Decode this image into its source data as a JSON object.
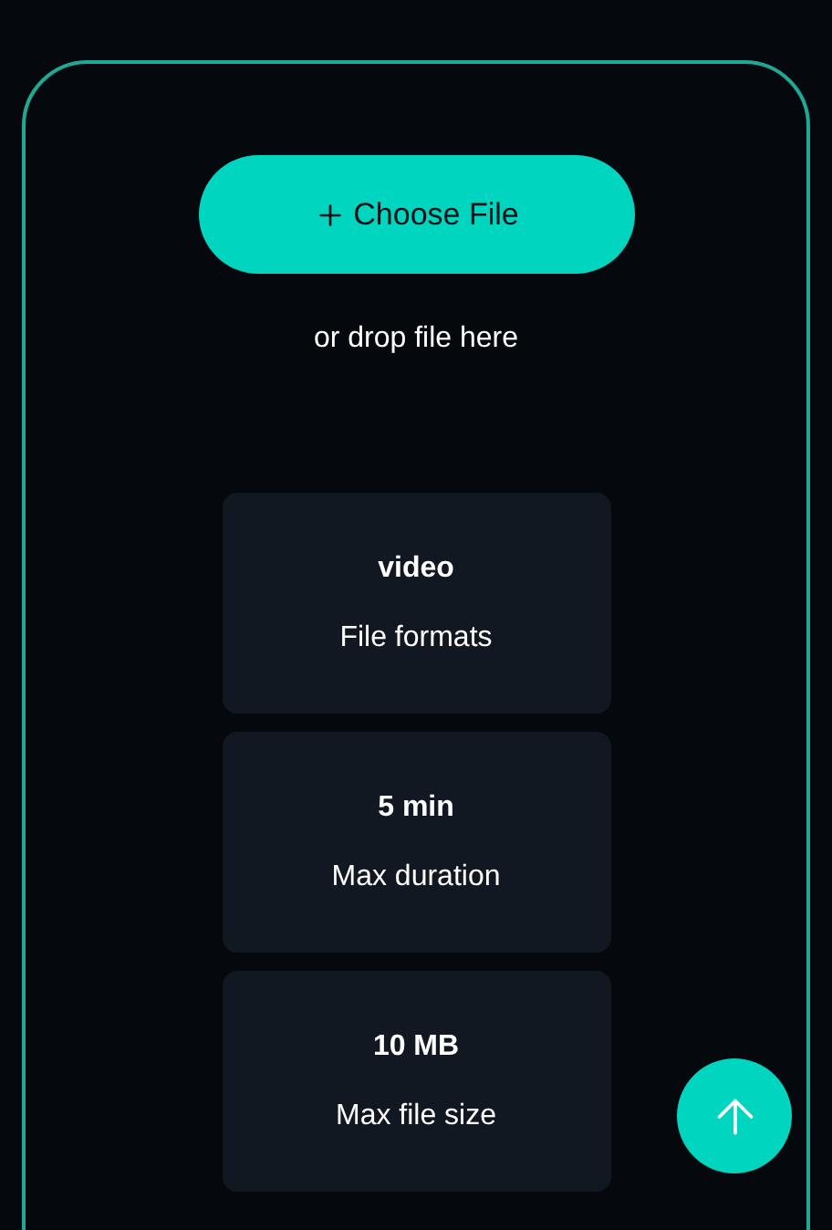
{
  "upload": {
    "button": "Choose File",
    "hint": "or drop file here"
  },
  "limits": [
    {
      "value": "video",
      "label": "File formats"
    },
    {
      "value": "5 min",
      "label": "Max duration"
    },
    {
      "value": "10 MB",
      "label": "Max file size"
    }
  ]
}
